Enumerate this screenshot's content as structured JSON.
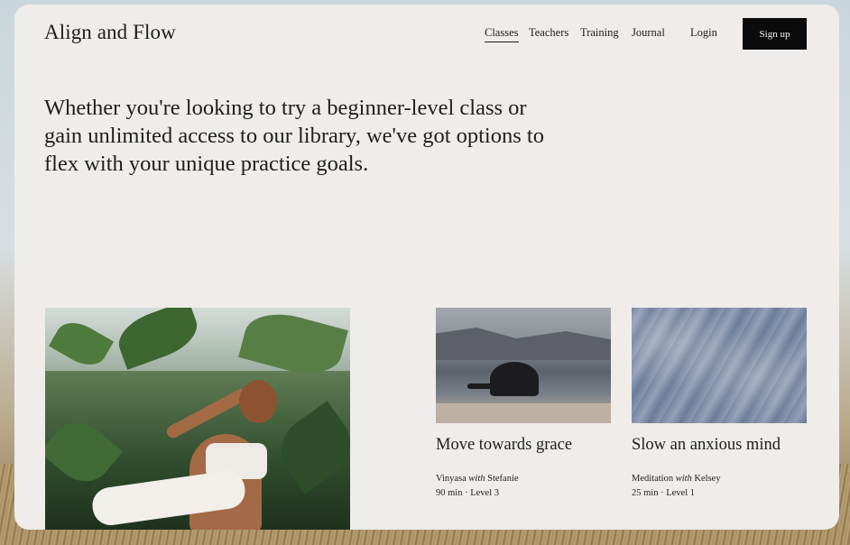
{
  "brand": "Align and Flow",
  "nav": {
    "classes": "Classes",
    "teachers": "Teachers",
    "training": "Training",
    "journal": "Journal",
    "login": "Login",
    "signup": "Sign up"
  },
  "intro": "Whether you're looking to try a beginner-level class or gain unlimited access to our library, we've got options to flex with your unique practice goals.",
  "cards": [
    {
      "title": "Move towards grace",
      "style": "Vinyasa",
      "with_word": "with",
      "teacher": "Stefanie",
      "duration": "90 min",
      "level": "Level 3"
    },
    {
      "title": "Slow an anxious mind",
      "style": "Meditation",
      "with_word": "with",
      "teacher": "Kelsey",
      "duration": "25 min",
      "level": "Level 1"
    }
  ]
}
